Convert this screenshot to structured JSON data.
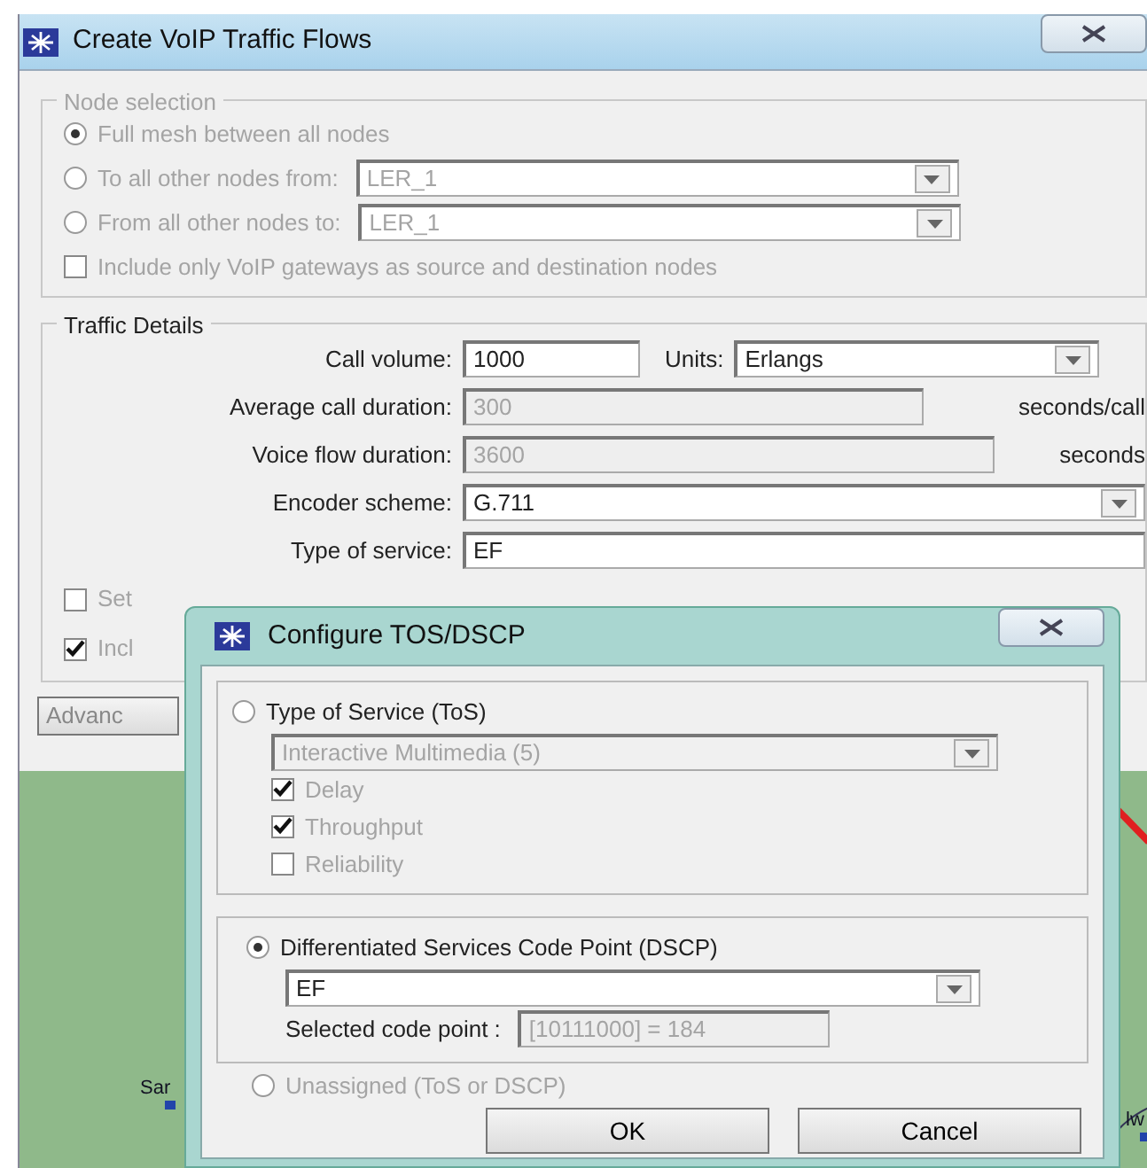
{
  "window": {
    "title": "Create VoIP Traffic Flows"
  },
  "node_selection": {
    "title": "Node selection",
    "disabled": true,
    "options": [
      {
        "kind": "radio",
        "label": "Full mesh between all nodes",
        "selected": true
      },
      {
        "kind": "radio-select",
        "label": "To all other nodes from:",
        "selected": false,
        "value": "LER_1"
      },
      {
        "kind": "radio-select",
        "label": "From all other nodes to:",
        "selected": false,
        "value": "LER_1"
      }
    ],
    "gateways_only": {
      "label": "Include only VoIP gateways as source and destination nodes",
      "checked": false
    }
  },
  "traffic_details": {
    "title": "Traffic Details",
    "fields": [
      {
        "kind": "units",
        "label": "Call volume:",
        "value": "1000",
        "units_label": "Units:",
        "units_value": "Erlangs"
      },
      {
        "kind": "suffix",
        "label": "Average call duration:",
        "value": "300",
        "suffix": "seconds/call",
        "disabled": true
      },
      {
        "kind": "suffix",
        "label": "Voice flow duration:",
        "value": "3600",
        "suffix": "seconds",
        "disabled": true
      },
      {
        "kind": "select",
        "label": "Encoder scheme:",
        "value": "G.711"
      },
      {
        "kind": "text",
        "label": "Type of service:",
        "value": "EF"
      }
    ],
    "options": [
      {
        "label": "Set",
        "checked": false
      },
      {
        "label": "Incl",
        "checked": true
      }
    ]
  },
  "advanced_button": "Advanc",
  "map": {
    "nodes": [
      {
        "label": "Sar"
      },
      {
        "label": "lw"
      }
    ]
  },
  "dialog": {
    "title": "Configure TOS/DSCP",
    "tos": {
      "label": "Type of Service (ToS)",
      "selected": false,
      "value": "Interactive Multimedia (5)",
      "flags": [
        {
          "label": "Delay",
          "checked": true
        },
        {
          "label": "Throughput",
          "checked": true
        },
        {
          "label": "Reliability",
          "checked": false
        }
      ]
    },
    "dscp": {
      "label": "Differentiated Services Code Point (DSCP)",
      "selected": true,
      "value": "EF",
      "code_point_label": "Selected code point :",
      "code_point": "[10111000] = 184"
    },
    "unassigned": {
      "label": "Unassigned (ToS or DSCP)",
      "selected": false
    },
    "buttons": [
      "OK",
      "Cancel"
    ]
  }
}
